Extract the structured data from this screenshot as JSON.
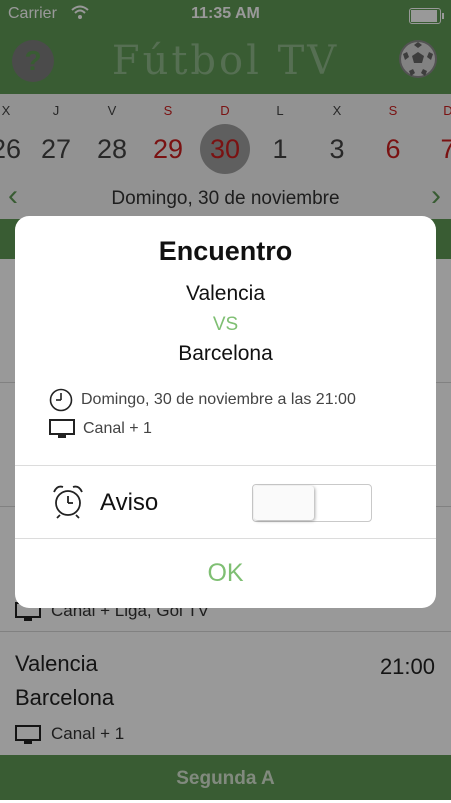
{
  "status": {
    "carrier": "Carrier",
    "time": "11:35 AM",
    "battery_percent": 100
  },
  "header": {
    "title": "Fútbol TV",
    "help_label": "?",
    "help_icon": "question-mark-icon",
    "ball_icon": "soccer-ball-icon"
  },
  "calendar": {
    "days": [
      {
        "letter": "X",
        "number": "26",
        "weekend": false,
        "selected": false
      },
      {
        "letter": "J",
        "number": "27",
        "weekend": false,
        "selected": false
      },
      {
        "letter": "V",
        "number": "28",
        "weekend": false,
        "selected": false
      },
      {
        "letter": "S",
        "number": "29",
        "weekend": true,
        "selected": false
      },
      {
        "letter": "D",
        "number": "30",
        "weekend": true,
        "selected": true
      },
      {
        "letter": "L",
        "number": "1",
        "weekend": false,
        "selected": false
      },
      {
        "letter": "X",
        "number": "3",
        "weekend": false,
        "selected": false
      },
      {
        "letter": "S",
        "number": "6",
        "weekend": true,
        "selected": false
      },
      {
        "letter": "D",
        "number": "7",
        "weekend": true,
        "selected": false
      }
    ],
    "current_date": "Domingo, 30 de noviembre",
    "prev_label": "‹",
    "next_label": "›"
  },
  "matches": [
    {
      "channel": "Canal + Liga, Gol TV"
    },
    {
      "home": "Valencia",
      "away": "Barcelona",
      "time": "21:00",
      "channel": "Canal + 1"
    }
  ],
  "footer": {
    "section": "Segunda A"
  },
  "dialog": {
    "title": "Encuentro",
    "home": "Valencia",
    "vs": "VS",
    "away": "Barcelona",
    "datetime": "Domingo, 30 de noviembre a las 21:00",
    "channel": "Canal + 1",
    "alarm_label": "Aviso",
    "alarm_enabled": false,
    "ok_label": "OK"
  },
  "colors": {
    "brand_green": "#5f9a55",
    "accent_green": "#7fbf73",
    "weekend_red": "#cc1f1f"
  }
}
